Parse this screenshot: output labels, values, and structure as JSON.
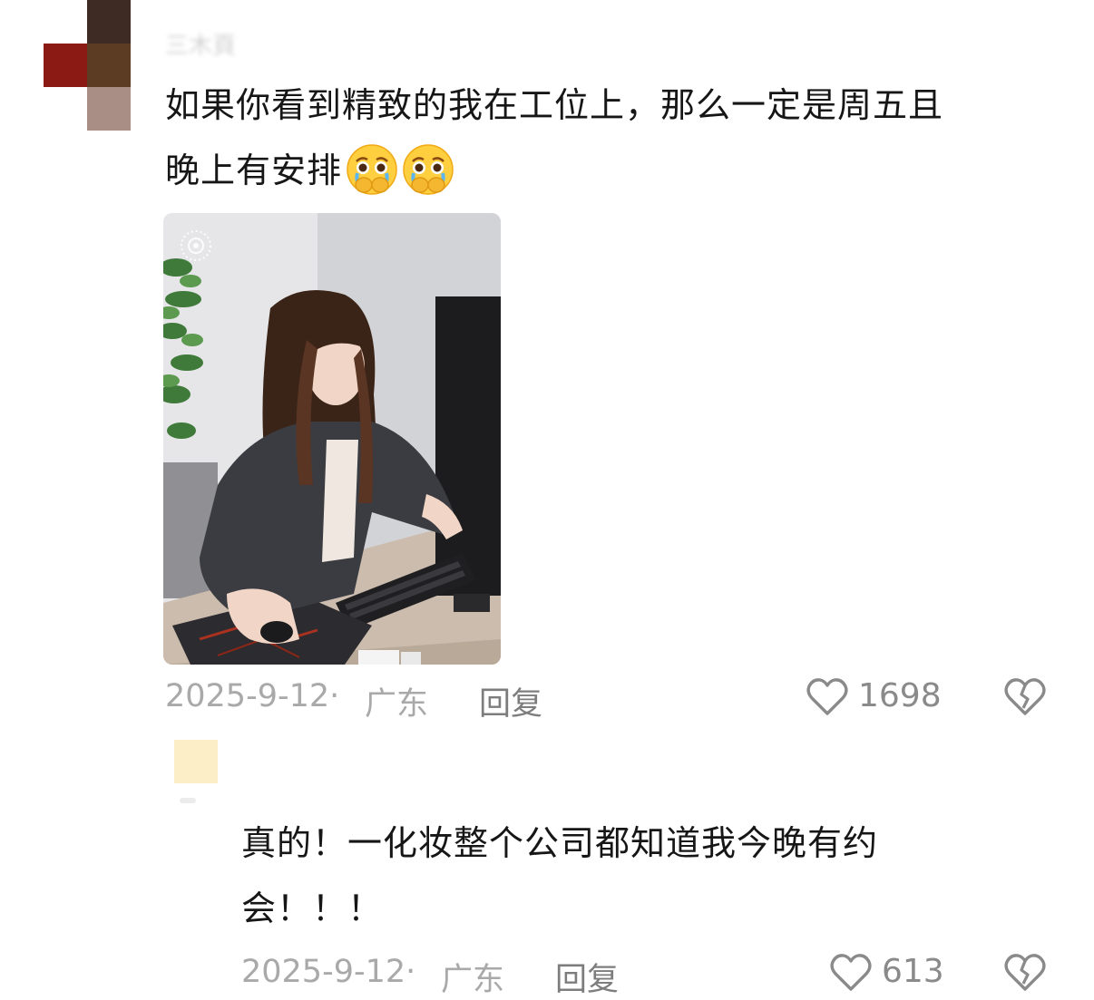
{
  "comments": [
    {
      "username": "三木頁",
      "text_line1": "如果你看到精致的我在工位上，那么一定是周五且",
      "text_line2": "晚上有安排",
      "emojis": [
        "crying-face-hands-over-mouth",
        "crying-face-hands-over-mouth"
      ],
      "date": "2025-9-12·",
      "location": "广东",
      "reply_label": "回复",
      "likes": "1698",
      "avatar_colors": [
        "#ffffff",
        "#3d2b24",
        "#8c1a14",
        "#5c3c22",
        "#ffffff",
        "#a88e84"
      ],
      "image_alt": "photo of woman at office desk using computer"
    },
    {
      "text_line1": "真的！一化妆整个公司都知道我今晚有约",
      "text_line2": "会！！！",
      "date": "2025-9-12·",
      "location": "广东",
      "reply_label": "回复",
      "likes": "613",
      "avatar_color": "#fcefc7"
    }
  ],
  "icons": {
    "like": "heart-outline-icon",
    "dislike": "broken-heart-icon"
  }
}
